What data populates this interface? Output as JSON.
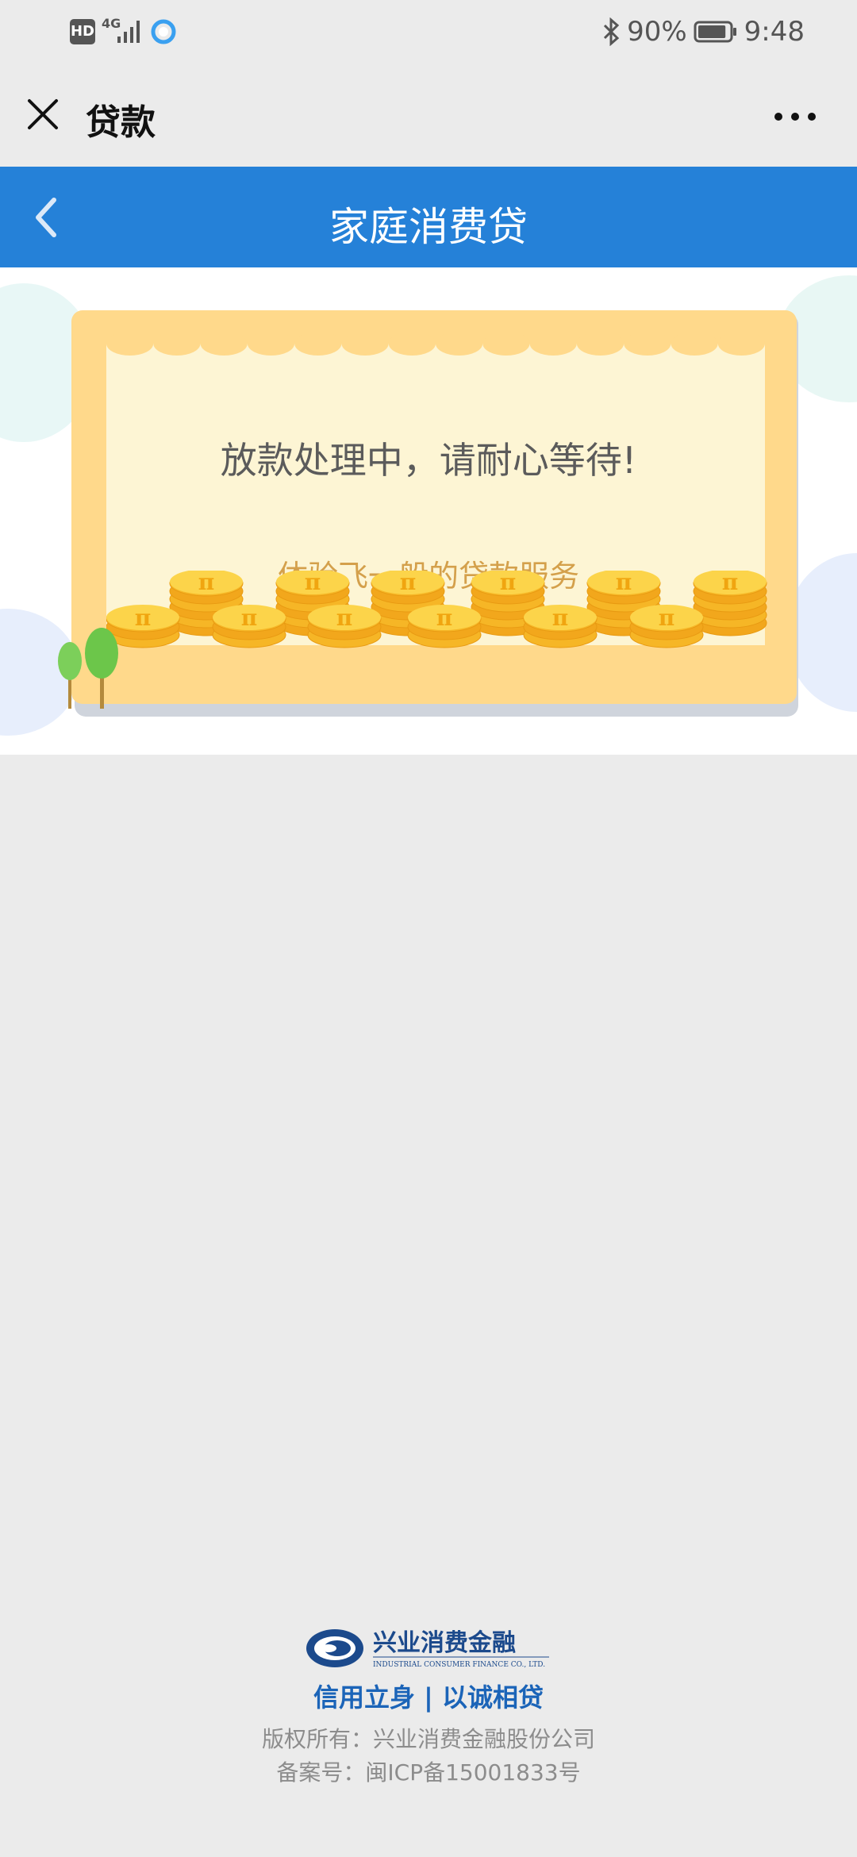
{
  "status_bar": {
    "hd_label": "HD",
    "network_label": "4G",
    "bluetooth_icon": "bluetooth-icon",
    "battery_percent": "90%",
    "battery_level": 0.9,
    "time": "9:48"
  },
  "title_bar": {
    "close_icon": "close-icon",
    "title": "贷款",
    "more_icon": "more-dots-icon"
  },
  "header": {
    "back_icon": "chevron-left-icon",
    "title": "家庭消费贷"
  },
  "banner": {
    "message": "放款处理中，请耐心等待!",
    "subtitle": "体验飞一般的贷款服务",
    "coin_symbol": "π"
  },
  "footer": {
    "logo_name": "兴业消费金融",
    "logo_english": "INDUSTRIAL CONSUMER FINANCE CO., LTD.",
    "slogan": "信用立身 | 以诚相贷",
    "copyright": "版权所有：兴业消费金融股份公司",
    "icp": "备案号：闽ICP备15001833号"
  },
  "colors": {
    "header_blue": "#2581d8",
    "background": "#ebebeb",
    "card_border": "#ffd98b",
    "card_fill": "#fdf5d4",
    "coin": "#f7c331",
    "slogan": "#1b64b8"
  }
}
